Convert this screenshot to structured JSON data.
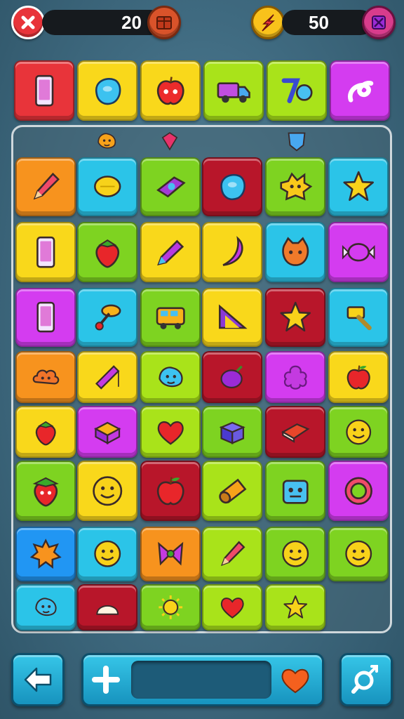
{
  "hud": {
    "left_counter": "20",
    "right_counter": "50"
  },
  "colors": {
    "red": "#e8343a",
    "orange": "#f7931e",
    "yellow": "#f9d81b",
    "green": "#7ed321",
    "lime": "#a9e31a",
    "cyan": "#2bc4e8",
    "magenta": "#d43cf0",
    "darkred": "#b8162a",
    "blue": "#2196f3"
  },
  "top_row": [
    {
      "color": "red",
      "icon": "phone-icon"
    },
    {
      "color": "yellow",
      "icon": "blob-icon"
    },
    {
      "color": "yellow",
      "icon": "apple-face-icon"
    },
    {
      "color": "lime",
      "icon": "truck-icon"
    },
    {
      "color": "lime",
      "icon": "number-icon"
    },
    {
      "color": "magenta",
      "icon": "swirl-icon"
    }
  ],
  "floaters": [
    {
      "icon": "blob-face-icon"
    },
    {
      "icon": "gem-icon"
    },
    {
      "icon": "shield-icon"
    }
  ],
  "grid": [
    [
      {
        "color": "orange",
        "icon": "pencil-icon"
      },
      {
        "color": "cyan",
        "icon": "lemon-icon"
      },
      {
        "color": "green",
        "icon": "box-icon"
      },
      {
        "color": "darkred",
        "icon": "blob-icon"
      },
      {
        "color": "green",
        "icon": "star-face-icon"
      },
      {
        "color": "cyan",
        "icon": "star-icon"
      }
    ],
    [
      {
        "color": "yellow",
        "icon": "phone-icon"
      },
      {
        "color": "green",
        "icon": "strawberry-icon"
      },
      {
        "color": "yellow",
        "icon": "crayon-icon"
      },
      {
        "color": "yellow",
        "icon": "banana-icon"
      },
      {
        "color": "cyan",
        "icon": "cat-face-icon"
      },
      {
        "color": "magenta",
        "icon": "candy-icon"
      }
    ],
    [
      {
        "color": "magenta",
        "icon": "phone-icon"
      },
      {
        "color": "cyan",
        "icon": "pin-icon"
      },
      {
        "color": "green",
        "icon": "bus-icon"
      },
      {
        "color": "yellow",
        "icon": "ruler-icon"
      },
      {
        "color": "darkred",
        "icon": "star-icon"
      },
      {
        "color": "cyan",
        "icon": "hammer-icon"
      }
    ],
    [
      {
        "color": "orange",
        "icon": "cloud-face-icon"
      },
      {
        "color": "yellow",
        "icon": "kite-icon"
      },
      {
        "color": "lime",
        "icon": "blob-face-icon"
      },
      {
        "color": "darkred",
        "icon": "plum-icon"
      },
      {
        "color": "magenta",
        "icon": "flower-icon"
      },
      {
        "color": "yellow",
        "icon": "apple-icon"
      }
    ],
    [
      {
        "color": "yellow",
        "icon": "strawberry-icon"
      },
      {
        "color": "magenta",
        "icon": "sandwich-icon"
      },
      {
        "color": "lime",
        "icon": "heart-icon"
      },
      {
        "color": "green",
        "icon": "cube-icon"
      },
      {
        "color": "darkred",
        "icon": "book-icon"
      },
      {
        "color": "green",
        "icon": "smiley-icon"
      }
    ],
    [
      {
        "color": "green",
        "icon": "strawberry-face-icon"
      },
      {
        "color": "yellow",
        "icon": "smiley-icon"
      },
      {
        "color": "darkred",
        "icon": "apple-icon"
      },
      {
        "color": "lime",
        "icon": "log-icon"
      },
      {
        "color": "green",
        "icon": "robot-icon"
      },
      {
        "color": "magenta",
        "icon": "ring-icon"
      }
    ],
    [
      {
        "color": "blue",
        "icon": "splat-icon"
      },
      {
        "color": "cyan",
        "icon": "smiley-icon"
      },
      {
        "color": "orange",
        "icon": "bow-icon"
      },
      {
        "color": "lime",
        "icon": "pencil-icon"
      },
      {
        "color": "green",
        "icon": "smiley-icon"
      },
      {
        "color": "green",
        "icon": "smiley-icon"
      }
    ],
    [
      {
        "color": "cyan",
        "icon": "blob-face-icon"
      },
      {
        "color": "darkred",
        "icon": "shell-icon"
      },
      {
        "color": "green",
        "icon": "sun-icon"
      },
      {
        "color": "lime",
        "icon": "heart-icon"
      },
      {
        "color": "lime",
        "icon": "star-icon"
      }
    ]
  ],
  "bottom": {
    "meter_level": 0.0
  }
}
